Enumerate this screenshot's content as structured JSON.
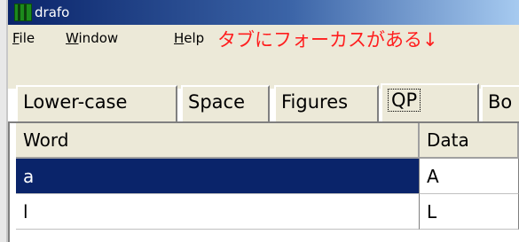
{
  "window": {
    "title": "drafo"
  },
  "menu": {
    "items": [
      {
        "accel": "F",
        "rest": "ile"
      },
      {
        "accel": "W",
        "rest": "indow"
      },
      {
        "accel": "H",
        "rest": "elp"
      }
    ]
  },
  "annotation": {
    "text": "タブにフォーカスがある↓",
    "color": "#ff1e1e"
  },
  "tabs": [
    {
      "label": "Lower-case",
      "selected": false
    },
    {
      "label": "Space",
      "selected": false
    },
    {
      "label": "Figures",
      "selected": false
    },
    {
      "label": "QP",
      "selected": true,
      "focused": true
    },
    {
      "label": "Bo",
      "selected": false
    }
  ],
  "grid": {
    "columns": [
      "Word",
      "Data"
    ],
    "rows": [
      {
        "word": "a",
        "data": "A",
        "selected": true
      },
      {
        "word": "l",
        "data": "L",
        "selected": false
      }
    ]
  },
  "colors": {
    "selection": "#0a246a",
    "titlebar": "#0a246a",
    "face": "#ece9d8"
  }
}
